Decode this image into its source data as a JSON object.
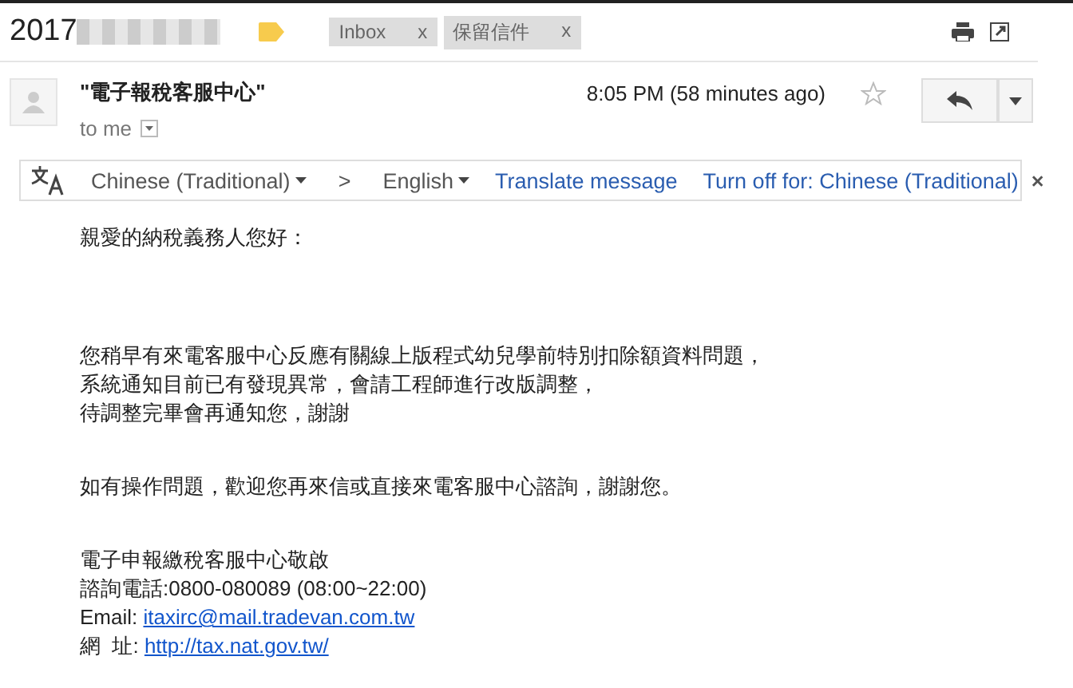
{
  "subject": {
    "text": "2017",
    "redacted": true
  },
  "labels": [
    {
      "text": "Inbox",
      "close": "x"
    },
    {
      "text": "保留信件",
      "close": "x"
    }
  ],
  "message": {
    "sender": "\"電子報稅客服中心\"",
    "recipient": "to me",
    "time": "8:05 PM (58 minutes ago)",
    "starred": false
  },
  "translate_bar": {
    "from": "Chinese (Traditional)",
    "separator": ">",
    "to": "English",
    "translate": "Translate message",
    "turn_off": "Turn off for: Chinese (Traditional)",
    "close": "×"
  },
  "body": [
    [
      "親愛的納稅義務人您好："
    ],
    [
      "您稍早有來電客服中心反應有關線上版程式幼兒學前特別扣除額資料問題，",
      "系統通知目前已有發現異常，會請工程師進行改版調整，",
      "待調整完畢會再通知您，謝謝"
    ],
    [
      "如有操作問題，歡迎您再來信或直接來電客服中心諮詢，謝謝您。"
    ]
  ],
  "signature": [
    {
      "label": "電子申報繳稅客服中心敬啟"
    },
    {
      "label": "諮詢電話:0800-080089 (08:00~22:00)"
    },
    {
      "label": "Email: ",
      "link": "itaxirc@mail.tradevan.com.tw"
    },
    {
      "label": "網  址: ",
      "link": "http://tax.nat.gov.tw/"
    }
  ]
}
